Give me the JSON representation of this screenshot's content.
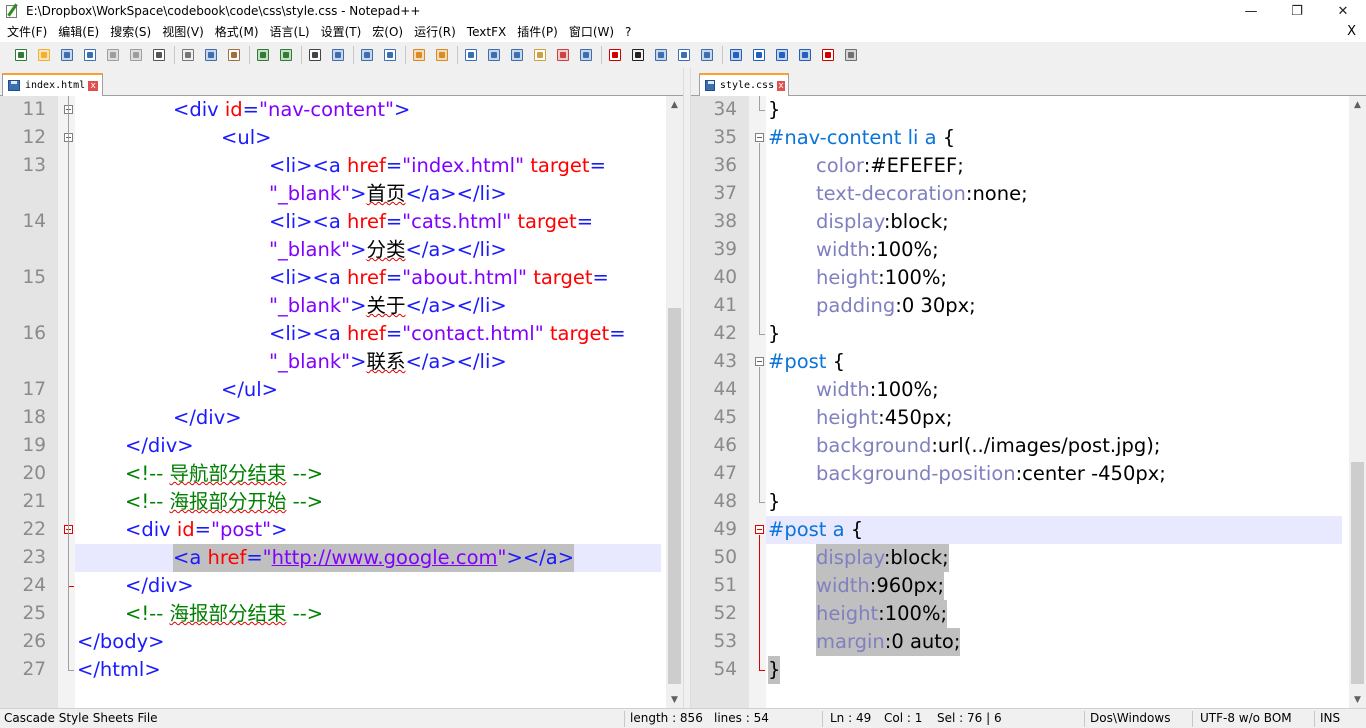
{
  "window": {
    "title": "E:\\Dropbox\\WorkSpace\\codebook\\code\\css\\style.css - Notepad++",
    "minimize": "—",
    "maximize": "❐",
    "close": "✕"
  },
  "menu": {
    "items": [
      "文件(F)",
      "编辑(E)",
      "搜索(S)",
      "视图(V)",
      "格式(M)",
      "语言(L)",
      "设置(T)",
      "宏(O)",
      "运行(R)",
      "TextFX",
      "插件(P)",
      "窗口(W)",
      "?"
    ],
    "close": "X"
  },
  "toolbar": {
    "icons": [
      "new-file-icon",
      "open-file-icon",
      "save-icon",
      "save-all-icon",
      "close-icon",
      "close-all-icon",
      "print-icon",
      "cut-icon",
      "copy-icon",
      "paste-icon",
      "undo-icon",
      "redo-icon",
      "find-icon",
      "replace-icon",
      "zoom-in-icon",
      "zoom-out-icon",
      "sync-vertical-icon",
      "sync-horizontal-icon",
      "word-wrap-icon",
      "show-all-chars-icon",
      "indent-guide-icon",
      "user-defined-icon",
      "doc-map-icon",
      "function-list-icon",
      "record-macro-icon",
      "stop-record-icon",
      "play-macro-icon",
      "run-multiple-icon",
      "save-macro-icon",
      "first-icon",
      "up-icon",
      "down-icon",
      "last-icon",
      "spell-check-icon",
      "plugin-icon"
    ]
  },
  "left_pane": {
    "tab": {
      "label": "index.html",
      "close": "x"
    },
    "lines": [
      {
        "n": "11",
        "indent": 2,
        "tokens": [
          [
            "tag",
            "<div "
          ],
          [
            "attr",
            "id"
          ],
          [
            "tag",
            "="
          ],
          [
            "str",
            "\"nav-content\""
          ],
          [
            "tag",
            ">"
          ]
        ]
      },
      {
        "n": "12",
        "indent": 3,
        "tokens": [
          [
            "tag",
            "<ul>"
          ]
        ]
      },
      {
        "n": "13",
        "indent": 4,
        "tokens": [
          [
            "tag",
            "<li><a "
          ],
          [
            "attr",
            "href"
          ],
          [
            "tag",
            "="
          ],
          [
            "str",
            "\"index.html\""
          ],
          [
            "tag",
            " "
          ],
          [
            "attr",
            "target"
          ],
          [
            "tag",
            "="
          ]
        ]
      },
      {
        "n": "",
        "indent": 4,
        "tokens": [
          [
            "str",
            "\"_blank\""
          ],
          [
            "tag",
            ">"
          ],
          [
            "txt",
            "首页"
          ],
          [
            "tag",
            "</a></li>"
          ]
        ]
      },
      {
        "n": "14",
        "indent": 4,
        "tokens": [
          [
            "tag",
            "<li><a "
          ],
          [
            "attr",
            "href"
          ],
          [
            "tag",
            "="
          ],
          [
            "str",
            "\"cats.html\""
          ],
          [
            "tag",
            " "
          ],
          [
            "attr",
            "target"
          ],
          [
            "tag",
            "="
          ]
        ]
      },
      {
        "n": "",
        "indent": 4,
        "tokens": [
          [
            "str",
            "\"_blank\""
          ],
          [
            "tag",
            ">"
          ],
          [
            "txt",
            "分类"
          ],
          [
            "tag",
            "</a></li>"
          ]
        ]
      },
      {
        "n": "15",
        "indent": 4,
        "tokens": [
          [
            "tag",
            "<li><a "
          ],
          [
            "attr",
            "href"
          ],
          [
            "tag",
            "="
          ],
          [
            "str",
            "\"about.html\""
          ],
          [
            "tag",
            " "
          ],
          [
            "attr",
            "target"
          ],
          [
            "tag",
            "="
          ]
        ]
      },
      {
        "n": "",
        "indent": 4,
        "tokens": [
          [
            "str",
            "\"_blank\""
          ],
          [
            "tag",
            ">"
          ],
          [
            "txt",
            "关于"
          ],
          [
            "tag",
            "</a></li>"
          ]
        ]
      },
      {
        "n": "16",
        "indent": 4,
        "tokens": [
          [
            "tag",
            "<li><a "
          ],
          [
            "attr",
            "href"
          ],
          [
            "tag",
            "="
          ],
          [
            "str",
            "\"contact.html\""
          ],
          [
            "tag",
            " "
          ],
          [
            "attr",
            "target"
          ],
          [
            "tag",
            "="
          ]
        ]
      },
      {
        "n": "",
        "indent": 4,
        "tokens": [
          [
            "str",
            "\"_blank\""
          ],
          [
            "tag",
            ">"
          ],
          [
            "txt",
            "联系"
          ],
          [
            "tag",
            "</a></li>"
          ]
        ]
      },
      {
        "n": "17",
        "indent": 3,
        "tokens": [
          [
            "tag",
            "</ul>"
          ]
        ]
      },
      {
        "n": "18",
        "indent": 2,
        "tokens": [
          [
            "tag",
            "</div>"
          ]
        ]
      },
      {
        "n": "19",
        "indent": 1,
        "tokens": [
          [
            "tag",
            "</div>"
          ]
        ]
      },
      {
        "n": "20",
        "indent": 1,
        "tokens": [
          [
            "cmt",
            "<!-- "
          ],
          [
            "cmt",
            "导航部分结束"
          ],
          [
            "cmt",
            " -->"
          ]
        ]
      },
      {
        "n": "21",
        "indent": 1,
        "tokens": [
          [
            "cmt",
            "<!-- "
          ],
          [
            "cmt",
            "海报部分开始"
          ],
          [
            "cmt",
            " -->"
          ]
        ]
      },
      {
        "n": "22",
        "indent": 1,
        "tokens": [
          [
            "tag",
            "<div "
          ],
          [
            "attr",
            "id"
          ],
          [
            "tag",
            "="
          ],
          [
            "str",
            "\"post\""
          ],
          [
            "tag",
            ">"
          ]
        ]
      },
      {
        "n": "23",
        "indent": 2,
        "tokens": [
          [
            "tag",
            "<a "
          ],
          [
            "attr",
            "href"
          ],
          [
            "tag",
            "="
          ],
          [
            "str",
            "\""
          ],
          [
            "link",
            "http://www.google.com"
          ],
          [
            "str",
            "\""
          ],
          [
            "tag",
            "></a>"
          ]
        ]
      },
      {
        "n": "24",
        "indent": 1,
        "tokens": [
          [
            "tag",
            "</div>"
          ]
        ]
      },
      {
        "n": "25",
        "indent": 1,
        "tokens": [
          [
            "cmt",
            "<!-- "
          ],
          [
            "cmt",
            "海报部分结束"
          ],
          [
            "cmt",
            " -->"
          ]
        ]
      },
      {
        "n": "26",
        "indent": 0,
        "tokens": [
          [
            "tag",
            "</body>"
          ]
        ]
      },
      {
        "n": "27",
        "indent": 0,
        "tokens": [
          [
            "tag",
            "</html>"
          ]
        ]
      }
    ]
  },
  "right_pane": {
    "tab": {
      "label": "style.css",
      "close": "x"
    },
    "lines": [
      {
        "n": "34",
        "indent": 0,
        "tokens": [
          [
            "brace",
            "}"
          ]
        ]
      },
      {
        "n": "35",
        "indent": 0,
        "tokens": [
          [
            "cid",
            "#nav-content"
          ],
          [
            "brace",
            " "
          ],
          [
            "cid",
            "li a"
          ],
          [
            "brace",
            " {"
          ]
        ]
      },
      {
        "n": "36",
        "indent": 1,
        "tokens": [
          [
            "prop",
            "color"
          ],
          [
            "val",
            ":#EFEFEF;"
          ]
        ]
      },
      {
        "n": "37",
        "indent": 1,
        "tokens": [
          [
            "prop",
            "text-decoration"
          ],
          [
            "val",
            ":none;"
          ]
        ]
      },
      {
        "n": "38",
        "indent": 1,
        "tokens": [
          [
            "prop",
            "display"
          ],
          [
            "val",
            ":block;"
          ]
        ]
      },
      {
        "n": "39",
        "indent": 1,
        "tokens": [
          [
            "prop",
            "width"
          ],
          [
            "val",
            ":100%;"
          ]
        ]
      },
      {
        "n": "40",
        "indent": 1,
        "tokens": [
          [
            "prop",
            "height"
          ],
          [
            "val",
            ":100%;"
          ]
        ]
      },
      {
        "n": "41",
        "indent": 1,
        "tokens": [
          [
            "prop",
            "padding"
          ],
          [
            "val",
            ":0 30px;"
          ]
        ]
      },
      {
        "n": "42",
        "indent": 0,
        "tokens": [
          [
            "brace",
            "}"
          ]
        ]
      },
      {
        "n": "43",
        "indent": 0,
        "tokens": [
          [
            "cid",
            "#post"
          ],
          [
            "brace",
            " {"
          ]
        ]
      },
      {
        "n": "44",
        "indent": 1,
        "tokens": [
          [
            "prop",
            "width"
          ],
          [
            "val",
            ":100%;"
          ]
        ]
      },
      {
        "n": "45",
        "indent": 1,
        "tokens": [
          [
            "prop",
            "height"
          ],
          [
            "val",
            ":450px;"
          ]
        ]
      },
      {
        "n": "46",
        "indent": 1,
        "tokens": [
          [
            "prop",
            "background"
          ],
          [
            "val",
            ":url(../images/post.jpg);"
          ]
        ]
      },
      {
        "n": "47",
        "indent": 1,
        "tokens": [
          [
            "prop",
            "background-position"
          ],
          [
            "val",
            ":center -450px;"
          ]
        ]
      },
      {
        "n": "48",
        "indent": 0,
        "tokens": [
          [
            "brace",
            "}"
          ]
        ]
      },
      {
        "n": "49",
        "indent": 0,
        "tokens": [
          [
            "cid",
            "#post"
          ],
          [
            "brace",
            " "
          ],
          [
            "cid",
            "a"
          ],
          [
            "brace",
            " {"
          ]
        ]
      },
      {
        "n": "50",
        "indent": 1,
        "tokens": [
          [
            "prop",
            "display"
          ],
          [
            "val",
            ":block;"
          ]
        ]
      },
      {
        "n": "51",
        "indent": 1,
        "tokens": [
          [
            "prop",
            "width"
          ],
          [
            "val",
            ":960px;"
          ]
        ]
      },
      {
        "n": "52",
        "indent": 1,
        "tokens": [
          [
            "prop",
            "height"
          ],
          [
            "val",
            ":100%;"
          ]
        ]
      },
      {
        "n": "53",
        "indent": 1,
        "tokens": [
          [
            "prop",
            "margin"
          ],
          [
            "val",
            ":0 auto;"
          ]
        ]
      },
      {
        "n": "54",
        "indent": 0,
        "tokens": [
          [
            "brace",
            "}"
          ]
        ]
      }
    ]
  },
  "status": {
    "file_type": "Cascade Style Sheets File",
    "length": "length : 856",
    "lines": "lines : 54",
    "ln": "Ln : 49",
    "col": "Col : 1",
    "sel": "Sel : 76 | 6",
    "eol": "Dos\\Windows",
    "encoding": "UTF-8 w/o BOM",
    "mode": "INS"
  },
  "colors": {
    "tag": "#1a1aff",
    "attr": "#ff0000",
    "string": "#8000ff",
    "comment": "#008000",
    "css_selector": "#0a74da",
    "css_property": "#8080c0",
    "tab_accent": "#f9a030"
  }
}
